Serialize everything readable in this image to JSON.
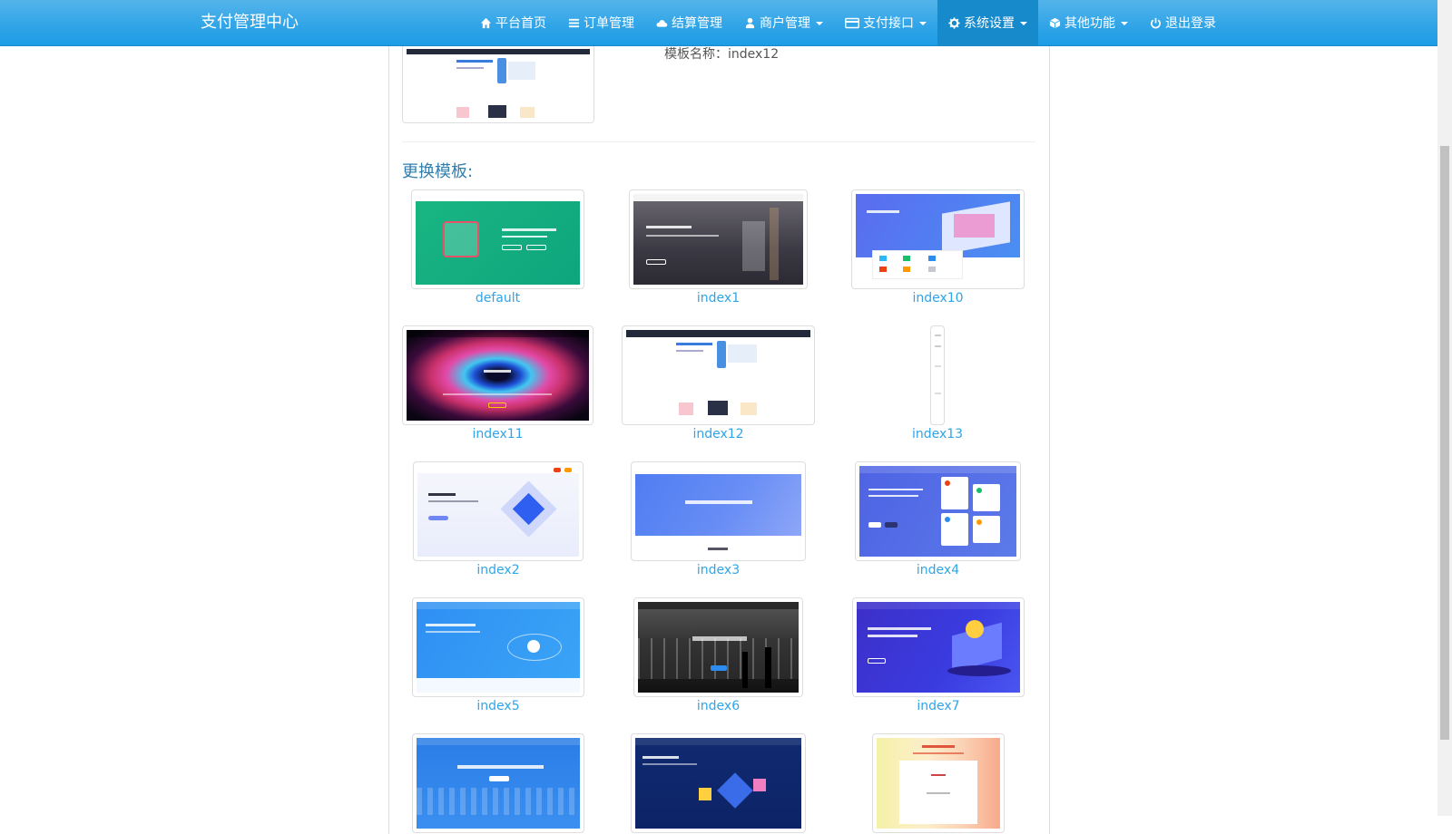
{
  "navbar": {
    "brand": "支付管理中心",
    "items": [
      {
        "label": "平台首页",
        "icon": "home-icon",
        "dropdown": false,
        "active": false
      },
      {
        "label": "订单管理",
        "icon": "list-icon",
        "dropdown": false,
        "active": false
      },
      {
        "label": "结算管理",
        "icon": "cloud-icon",
        "dropdown": false,
        "active": false
      },
      {
        "label": "商户管理",
        "icon": "user-icon",
        "dropdown": true,
        "active": false
      },
      {
        "label": "支付接口",
        "icon": "credit-card-icon",
        "dropdown": true,
        "active": false
      },
      {
        "label": "系统设置",
        "icon": "gear-icon",
        "dropdown": true,
        "active": true
      },
      {
        "label": "其他功能",
        "icon": "cube-icon",
        "dropdown": true,
        "active": false
      },
      {
        "label": "退出登录",
        "icon": "power-icon",
        "dropdown": false,
        "active": false
      }
    ]
  },
  "current": {
    "name_label": "模板名称：index12"
  },
  "change_title": "更换模板:",
  "templates": [
    {
      "name": "default"
    },
    {
      "name": "index1"
    },
    {
      "name": "index10"
    },
    {
      "name": "index11"
    },
    {
      "name": "index12"
    },
    {
      "name": "index13"
    },
    {
      "name": "index2"
    },
    {
      "name": "index3"
    },
    {
      "name": "index4"
    },
    {
      "name": "index5"
    },
    {
      "name": "index6"
    },
    {
      "name": "index7"
    },
    {
      "name": ""
    },
    {
      "name": ""
    },
    {
      "name": ""
    }
  ],
  "colors": {
    "navbar": "#2fa4e7",
    "navbar_active": "#178acc",
    "link": "#2fa4e7",
    "title": "#317eac"
  }
}
